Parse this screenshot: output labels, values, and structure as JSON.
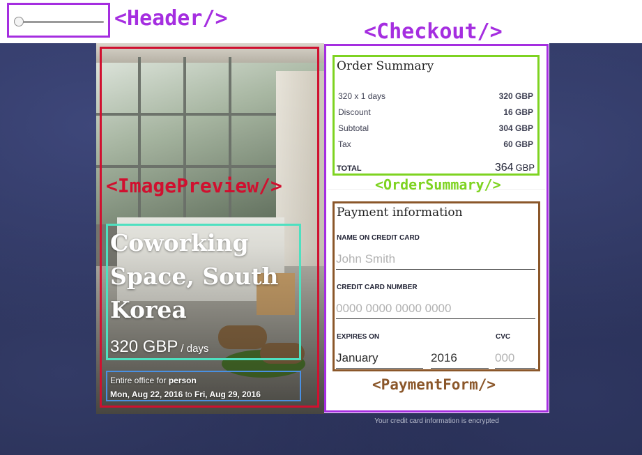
{
  "annotations": {
    "header": {
      "label": "<Header/>",
      "color": "#a52ee0"
    },
    "checkout": {
      "label": "<Checkout/>",
      "color": "#a52ee0"
    },
    "image_preview": {
      "label": "<ImagePreview/>",
      "color": "#d0102f"
    },
    "order_summary": {
      "label": "<OrderSummary/>",
      "color": "#7ed321"
    },
    "payment_form": {
      "label": "<PaymentForm/>",
      "color": "#8b572a"
    },
    "title_box_color": "#4ee0c0",
    "booking_box_color": "#4a90e2"
  },
  "header": {
    "slider": {
      "value": 0.0
    }
  },
  "preview": {
    "title": "Coworking Space, South Korea",
    "price": "320 GBP",
    "price_unit": "/ days",
    "booking_prefix": "Entire office for ",
    "booking_who": "person",
    "date_from": "Mon, Aug 22, 2016",
    "date_to_word": " to ",
    "date_to": "Fri, Aug 29, 2016"
  },
  "order_summary": {
    "title": "Order Summary",
    "rows": [
      {
        "label": "320 x 1 days",
        "value": "320 GBP"
      },
      {
        "label": "Discount",
        "value": "16 GBP"
      },
      {
        "label": "Subtotal",
        "value": "304 GBP"
      },
      {
        "label": "Tax",
        "value": "60 GBP"
      }
    ],
    "total_label": "TOTAL",
    "total_value": "364",
    "total_currency": "GBP"
  },
  "payment": {
    "title": "Payment information",
    "name_label": "NAME ON CREDIT CARD",
    "name_placeholder": "John Smith",
    "card_label": "CREDIT CARD NUMBER",
    "card_placeholder": "0000 0000 0000 0000",
    "expires_label": "EXPIRES ON",
    "month_value": "January",
    "year_value": "2016",
    "cvc_label": "CVC",
    "cvc_placeholder": "000"
  },
  "footer": {
    "note": "Your credit card information is encrypted"
  }
}
